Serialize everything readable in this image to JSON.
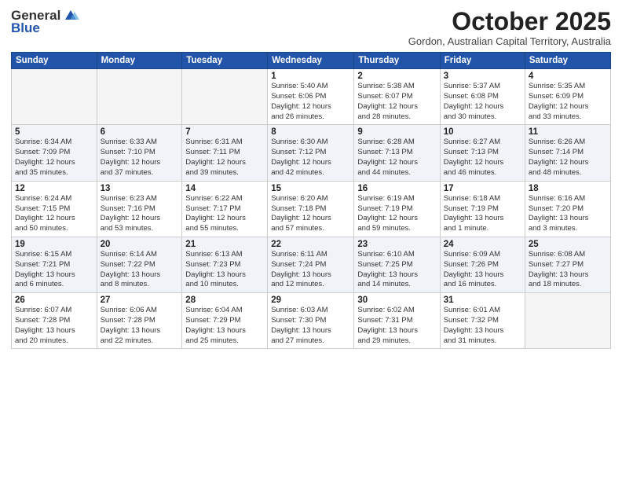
{
  "logo": {
    "general": "General",
    "blue": "Blue"
  },
  "header": {
    "title": "October 2025",
    "subtitle": "Gordon, Australian Capital Territory, Australia"
  },
  "weekdays": [
    "Sunday",
    "Monday",
    "Tuesday",
    "Wednesday",
    "Thursday",
    "Friday",
    "Saturday"
  ],
  "weeks": [
    [
      {
        "day": "",
        "info": ""
      },
      {
        "day": "",
        "info": ""
      },
      {
        "day": "",
        "info": ""
      },
      {
        "day": "1",
        "info": "Sunrise: 5:40 AM\nSunset: 6:06 PM\nDaylight: 12 hours\nand 26 minutes."
      },
      {
        "day": "2",
        "info": "Sunrise: 5:38 AM\nSunset: 6:07 PM\nDaylight: 12 hours\nand 28 minutes."
      },
      {
        "day": "3",
        "info": "Sunrise: 5:37 AM\nSunset: 6:08 PM\nDaylight: 12 hours\nand 30 minutes."
      },
      {
        "day": "4",
        "info": "Sunrise: 5:35 AM\nSunset: 6:09 PM\nDaylight: 12 hours\nand 33 minutes."
      }
    ],
    [
      {
        "day": "5",
        "info": "Sunrise: 6:34 AM\nSunset: 7:09 PM\nDaylight: 12 hours\nand 35 minutes."
      },
      {
        "day": "6",
        "info": "Sunrise: 6:33 AM\nSunset: 7:10 PM\nDaylight: 12 hours\nand 37 minutes."
      },
      {
        "day": "7",
        "info": "Sunrise: 6:31 AM\nSunset: 7:11 PM\nDaylight: 12 hours\nand 39 minutes."
      },
      {
        "day": "8",
        "info": "Sunrise: 6:30 AM\nSunset: 7:12 PM\nDaylight: 12 hours\nand 42 minutes."
      },
      {
        "day": "9",
        "info": "Sunrise: 6:28 AM\nSunset: 7:13 PM\nDaylight: 12 hours\nand 44 minutes."
      },
      {
        "day": "10",
        "info": "Sunrise: 6:27 AM\nSunset: 7:13 PM\nDaylight: 12 hours\nand 46 minutes."
      },
      {
        "day": "11",
        "info": "Sunrise: 6:26 AM\nSunset: 7:14 PM\nDaylight: 12 hours\nand 48 minutes."
      }
    ],
    [
      {
        "day": "12",
        "info": "Sunrise: 6:24 AM\nSunset: 7:15 PM\nDaylight: 12 hours\nand 50 minutes."
      },
      {
        "day": "13",
        "info": "Sunrise: 6:23 AM\nSunset: 7:16 PM\nDaylight: 12 hours\nand 53 minutes."
      },
      {
        "day": "14",
        "info": "Sunrise: 6:22 AM\nSunset: 7:17 PM\nDaylight: 12 hours\nand 55 minutes."
      },
      {
        "day": "15",
        "info": "Sunrise: 6:20 AM\nSunset: 7:18 PM\nDaylight: 12 hours\nand 57 minutes."
      },
      {
        "day": "16",
        "info": "Sunrise: 6:19 AM\nSunset: 7:19 PM\nDaylight: 12 hours\nand 59 minutes."
      },
      {
        "day": "17",
        "info": "Sunrise: 6:18 AM\nSunset: 7:19 PM\nDaylight: 13 hours\nand 1 minute."
      },
      {
        "day": "18",
        "info": "Sunrise: 6:16 AM\nSunset: 7:20 PM\nDaylight: 13 hours\nand 3 minutes."
      }
    ],
    [
      {
        "day": "19",
        "info": "Sunrise: 6:15 AM\nSunset: 7:21 PM\nDaylight: 13 hours\nand 6 minutes."
      },
      {
        "day": "20",
        "info": "Sunrise: 6:14 AM\nSunset: 7:22 PM\nDaylight: 13 hours\nand 8 minutes."
      },
      {
        "day": "21",
        "info": "Sunrise: 6:13 AM\nSunset: 7:23 PM\nDaylight: 13 hours\nand 10 minutes."
      },
      {
        "day": "22",
        "info": "Sunrise: 6:11 AM\nSunset: 7:24 PM\nDaylight: 13 hours\nand 12 minutes."
      },
      {
        "day": "23",
        "info": "Sunrise: 6:10 AM\nSunset: 7:25 PM\nDaylight: 13 hours\nand 14 minutes."
      },
      {
        "day": "24",
        "info": "Sunrise: 6:09 AM\nSunset: 7:26 PM\nDaylight: 13 hours\nand 16 minutes."
      },
      {
        "day": "25",
        "info": "Sunrise: 6:08 AM\nSunset: 7:27 PM\nDaylight: 13 hours\nand 18 minutes."
      }
    ],
    [
      {
        "day": "26",
        "info": "Sunrise: 6:07 AM\nSunset: 7:28 PM\nDaylight: 13 hours\nand 20 minutes."
      },
      {
        "day": "27",
        "info": "Sunrise: 6:06 AM\nSunset: 7:28 PM\nDaylight: 13 hours\nand 22 minutes."
      },
      {
        "day": "28",
        "info": "Sunrise: 6:04 AM\nSunset: 7:29 PM\nDaylight: 13 hours\nand 25 minutes."
      },
      {
        "day": "29",
        "info": "Sunrise: 6:03 AM\nSunset: 7:30 PM\nDaylight: 13 hours\nand 27 minutes."
      },
      {
        "day": "30",
        "info": "Sunrise: 6:02 AM\nSunset: 7:31 PM\nDaylight: 13 hours\nand 29 minutes."
      },
      {
        "day": "31",
        "info": "Sunrise: 6:01 AM\nSunset: 7:32 PM\nDaylight: 13 hours\nand 31 minutes."
      },
      {
        "day": "",
        "info": ""
      }
    ]
  ]
}
